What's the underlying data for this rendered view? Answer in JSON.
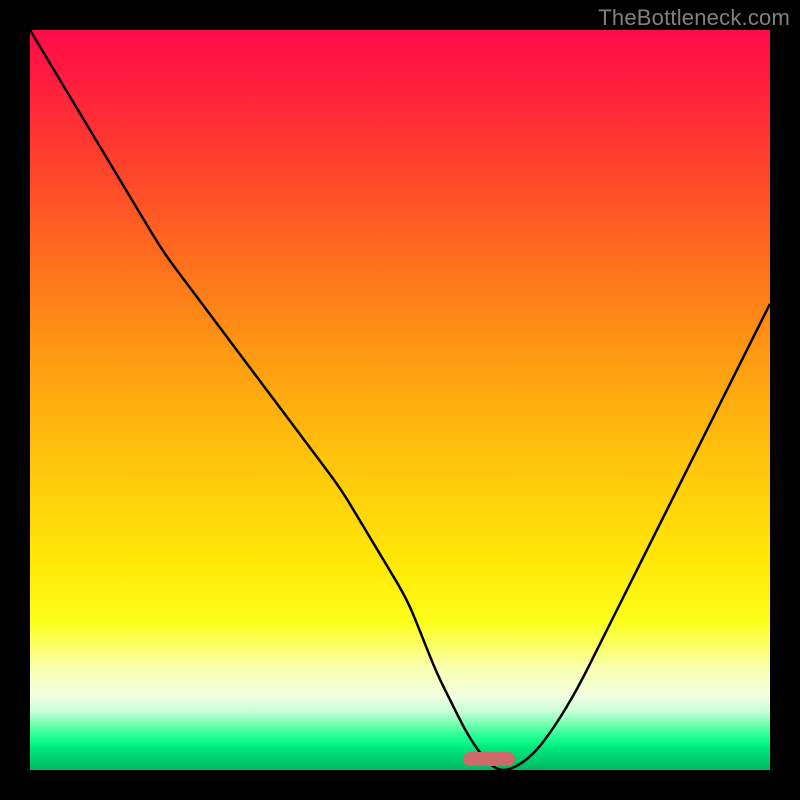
{
  "watermark": "TheBottleneck.com",
  "colors": {
    "frame": "#000000",
    "curve": "#000000",
    "marker": "#cf6a6a",
    "watermark": "#808080"
  },
  "chart_data": {
    "type": "line",
    "title": "",
    "xlabel": "",
    "ylabel": "",
    "xlim": [
      0,
      100
    ],
    "ylim": [
      0,
      100
    ],
    "grid": false,
    "x": [
      0,
      3,
      6,
      9,
      12,
      15,
      18,
      21,
      24,
      27,
      30,
      33,
      36,
      39,
      42,
      45,
      48,
      51,
      53,
      55,
      57,
      59,
      61,
      63,
      65,
      68,
      71,
      74,
      77,
      80,
      83,
      86,
      89,
      92,
      95,
      98,
      100
    ],
    "values": [
      100,
      95,
      90,
      85,
      80,
      75,
      70,
      66,
      62,
      58,
      54,
      50,
      46,
      42,
      38,
      33,
      28,
      23,
      18,
      13,
      9,
      5,
      2,
      0,
      0,
      2,
      6,
      11,
      17,
      23,
      29,
      35,
      41,
      47,
      53,
      59,
      63
    ],
    "marker": {
      "x": 62,
      "width_pct": 7,
      "y": 0
    },
    "annotations": []
  }
}
